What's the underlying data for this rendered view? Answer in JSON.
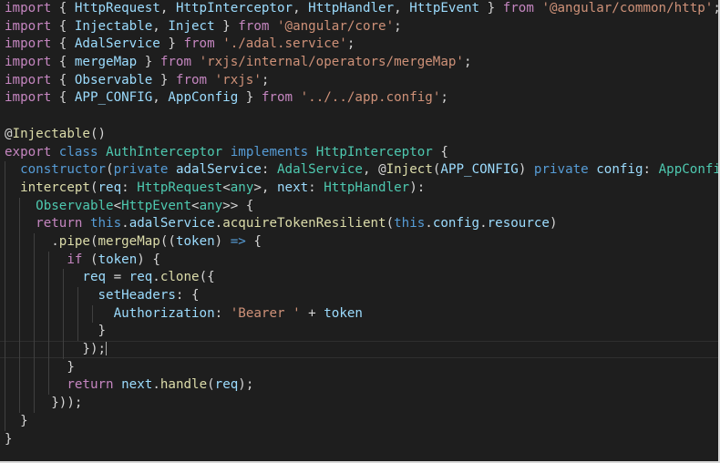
{
  "colors": {
    "background": "#1e1e1e",
    "plain": "#d4d4d4",
    "keyword": "#c586c0",
    "storage": "#569cd6",
    "variable": "#9cdcfe",
    "type": "#4ec9b0",
    "function": "#dcdcaa",
    "string": "#ce9178",
    "indent_guide": "#404040"
  },
  "editor": {
    "cursor_line": 19,
    "lines": [
      {
        "indent": 0,
        "guides": 0,
        "tokens": [
          {
            "t": "import",
            "c": "keyword"
          },
          {
            "t": " { ",
            "c": "plain"
          },
          {
            "t": "HttpRequest",
            "c": "variable"
          },
          {
            "t": ", ",
            "c": "plain"
          },
          {
            "t": "HttpInterceptor",
            "c": "variable"
          },
          {
            "t": ", ",
            "c": "plain"
          },
          {
            "t": "HttpHandler",
            "c": "variable"
          },
          {
            "t": ", ",
            "c": "plain"
          },
          {
            "t": "HttpEvent",
            "c": "variable"
          },
          {
            "t": " } ",
            "c": "plain"
          },
          {
            "t": "from",
            "c": "keyword"
          },
          {
            "t": " ",
            "c": "plain"
          },
          {
            "t": "'@angular/common/http'",
            "c": "string"
          },
          {
            "t": ";",
            "c": "plain"
          }
        ]
      },
      {
        "indent": 0,
        "guides": 0,
        "tokens": [
          {
            "t": "import",
            "c": "keyword"
          },
          {
            "t": " { ",
            "c": "plain"
          },
          {
            "t": "Injectable",
            "c": "variable"
          },
          {
            "t": ", ",
            "c": "plain"
          },
          {
            "t": "Inject",
            "c": "variable"
          },
          {
            "t": " } ",
            "c": "plain"
          },
          {
            "t": "from",
            "c": "keyword"
          },
          {
            "t": " ",
            "c": "plain"
          },
          {
            "t": "'@angular/core'",
            "c": "string"
          },
          {
            "t": ";",
            "c": "plain"
          }
        ]
      },
      {
        "indent": 0,
        "guides": 0,
        "tokens": [
          {
            "t": "import",
            "c": "keyword"
          },
          {
            "t": " { ",
            "c": "plain"
          },
          {
            "t": "AdalService",
            "c": "variable"
          },
          {
            "t": " } ",
            "c": "plain"
          },
          {
            "t": "from",
            "c": "keyword"
          },
          {
            "t": " ",
            "c": "plain"
          },
          {
            "t": "'./adal.service'",
            "c": "string"
          },
          {
            "t": ";",
            "c": "plain"
          }
        ]
      },
      {
        "indent": 0,
        "guides": 0,
        "tokens": [
          {
            "t": "import",
            "c": "keyword"
          },
          {
            "t": " { ",
            "c": "plain"
          },
          {
            "t": "mergeMap",
            "c": "variable"
          },
          {
            "t": " } ",
            "c": "plain"
          },
          {
            "t": "from",
            "c": "keyword"
          },
          {
            "t": " ",
            "c": "plain"
          },
          {
            "t": "'rxjs/internal/operators/mergeMap'",
            "c": "string"
          },
          {
            "t": ";",
            "c": "plain"
          }
        ]
      },
      {
        "indent": 0,
        "guides": 0,
        "tokens": [
          {
            "t": "import",
            "c": "keyword"
          },
          {
            "t": " { ",
            "c": "plain"
          },
          {
            "t": "Observable",
            "c": "variable"
          },
          {
            "t": " } ",
            "c": "plain"
          },
          {
            "t": "from",
            "c": "keyword"
          },
          {
            "t": " ",
            "c": "plain"
          },
          {
            "t": "'rxjs'",
            "c": "string"
          },
          {
            "t": ";",
            "c": "plain"
          }
        ]
      },
      {
        "indent": 0,
        "guides": 0,
        "tokens": [
          {
            "t": "import",
            "c": "keyword"
          },
          {
            "t": " { ",
            "c": "plain"
          },
          {
            "t": "APP_CONFIG",
            "c": "variable"
          },
          {
            "t": ", ",
            "c": "plain"
          },
          {
            "t": "AppConfig",
            "c": "variable"
          },
          {
            "t": " } ",
            "c": "plain"
          },
          {
            "t": "from",
            "c": "keyword"
          },
          {
            "t": " ",
            "c": "plain"
          },
          {
            "t": "'../../app.config'",
            "c": "string"
          },
          {
            "t": ";",
            "c": "plain"
          }
        ]
      },
      {
        "indent": 0,
        "guides": 0,
        "tokens": []
      },
      {
        "indent": 0,
        "guides": 0,
        "tokens": [
          {
            "t": "@",
            "c": "plain"
          },
          {
            "t": "Injectable",
            "c": "function"
          },
          {
            "t": "()",
            "c": "plain"
          }
        ]
      },
      {
        "indent": 0,
        "guides": 0,
        "tokens": [
          {
            "t": "export",
            "c": "keyword"
          },
          {
            "t": " ",
            "c": "plain"
          },
          {
            "t": "class",
            "c": "storage"
          },
          {
            "t": " ",
            "c": "plain"
          },
          {
            "t": "AuthInterceptor",
            "c": "type"
          },
          {
            "t": " ",
            "c": "plain"
          },
          {
            "t": "implements",
            "c": "storage"
          },
          {
            "t": " ",
            "c": "plain"
          },
          {
            "t": "HttpInterceptor",
            "c": "type"
          },
          {
            "t": " {",
            "c": "plain"
          }
        ]
      },
      {
        "indent": 2,
        "guides": 1,
        "tokens": [
          {
            "t": "constructor",
            "c": "storage"
          },
          {
            "t": "(",
            "c": "plain"
          },
          {
            "t": "private",
            "c": "storage"
          },
          {
            "t": " ",
            "c": "plain"
          },
          {
            "t": "adalService",
            "c": "variable"
          },
          {
            "t": ": ",
            "c": "plain"
          },
          {
            "t": "AdalService",
            "c": "type"
          },
          {
            "t": ", @",
            "c": "plain"
          },
          {
            "t": "Inject",
            "c": "function"
          },
          {
            "t": "(",
            "c": "plain"
          },
          {
            "t": "APP_CONFIG",
            "c": "variable"
          },
          {
            "t": ") ",
            "c": "plain"
          },
          {
            "t": "private",
            "c": "storage"
          },
          {
            "t": " ",
            "c": "plain"
          },
          {
            "t": "config",
            "c": "variable"
          },
          {
            "t": ": ",
            "c": "plain"
          },
          {
            "t": "AppConfig",
            "c": "type"
          },
          {
            "t": ") {}",
            "c": "plain"
          }
        ]
      },
      {
        "indent": 2,
        "guides": 1,
        "tokens": [
          {
            "t": "intercept",
            "c": "function"
          },
          {
            "t": "(",
            "c": "plain"
          },
          {
            "t": "req",
            "c": "variable"
          },
          {
            "t": ": ",
            "c": "plain"
          },
          {
            "t": "HttpRequest",
            "c": "type"
          },
          {
            "t": "<",
            "c": "plain"
          },
          {
            "t": "any",
            "c": "type"
          },
          {
            "t": ">, ",
            "c": "plain"
          },
          {
            "t": "next",
            "c": "variable"
          },
          {
            "t": ": ",
            "c": "plain"
          },
          {
            "t": "HttpHandler",
            "c": "type"
          },
          {
            "t": "):",
            "c": "plain"
          }
        ]
      },
      {
        "indent": 4,
        "guides": 2,
        "tokens": [
          {
            "t": "Observable",
            "c": "type"
          },
          {
            "t": "<",
            "c": "plain"
          },
          {
            "t": "HttpEvent",
            "c": "type"
          },
          {
            "t": "<",
            "c": "plain"
          },
          {
            "t": "any",
            "c": "type"
          },
          {
            "t": ">> {",
            "c": "plain"
          }
        ]
      },
      {
        "indent": 4,
        "guides": 2,
        "tokens": [
          {
            "t": "return",
            "c": "keyword"
          },
          {
            "t": " ",
            "c": "plain"
          },
          {
            "t": "this",
            "c": "storage"
          },
          {
            "t": ".",
            "c": "plain"
          },
          {
            "t": "adalService",
            "c": "variable"
          },
          {
            "t": ".",
            "c": "plain"
          },
          {
            "t": "acquireTokenResilient",
            "c": "function"
          },
          {
            "t": "(",
            "c": "plain"
          },
          {
            "t": "this",
            "c": "storage"
          },
          {
            "t": ".",
            "c": "plain"
          },
          {
            "t": "config",
            "c": "variable"
          },
          {
            "t": ".",
            "c": "plain"
          },
          {
            "t": "resource",
            "c": "variable"
          },
          {
            "t": ")",
            "c": "plain"
          }
        ]
      },
      {
        "indent": 6,
        "guides": 3,
        "tokens": [
          {
            "t": ".",
            "c": "plain"
          },
          {
            "t": "pipe",
            "c": "function"
          },
          {
            "t": "(",
            "c": "plain"
          },
          {
            "t": "mergeMap",
            "c": "function"
          },
          {
            "t": "((",
            "c": "plain"
          },
          {
            "t": "token",
            "c": "variable"
          },
          {
            "t": ") ",
            "c": "plain"
          },
          {
            "t": "=>",
            "c": "storage"
          },
          {
            "t": " {",
            "c": "plain"
          }
        ]
      },
      {
        "indent": 8,
        "guides": 4,
        "tokens": [
          {
            "t": "if",
            "c": "keyword"
          },
          {
            "t": " (",
            "c": "plain"
          },
          {
            "t": "token",
            "c": "variable"
          },
          {
            "t": ") {",
            "c": "plain"
          }
        ]
      },
      {
        "indent": 10,
        "guides": 5,
        "tokens": [
          {
            "t": "req",
            "c": "variable"
          },
          {
            "t": " = ",
            "c": "plain"
          },
          {
            "t": "req",
            "c": "variable"
          },
          {
            "t": ".",
            "c": "plain"
          },
          {
            "t": "clone",
            "c": "function"
          },
          {
            "t": "({",
            "c": "plain"
          }
        ]
      },
      {
        "indent": 12,
        "guides": 6,
        "tokens": [
          {
            "t": "setHeaders",
            "c": "variable"
          },
          {
            "t": ": {",
            "c": "plain"
          }
        ]
      },
      {
        "indent": 14,
        "guides": 7,
        "tokens": [
          {
            "t": "Authorization",
            "c": "variable"
          },
          {
            "t": ": ",
            "c": "plain"
          },
          {
            "t": "'Bearer '",
            "c": "string"
          },
          {
            "t": " + ",
            "c": "plain"
          },
          {
            "t": "token",
            "c": "variable"
          }
        ]
      },
      {
        "indent": 12,
        "guides": 6,
        "tokens": [
          {
            "t": "}",
            "c": "plain"
          }
        ]
      },
      {
        "indent": 10,
        "guides": 5,
        "tokens": [
          {
            "t": "});",
            "c": "plain"
          }
        ]
      },
      {
        "indent": 8,
        "guides": 4,
        "tokens": [
          {
            "t": "}",
            "c": "plain"
          }
        ]
      },
      {
        "indent": 8,
        "guides": 4,
        "tokens": [
          {
            "t": "return",
            "c": "keyword"
          },
          {
            "t": " ",
            "c": "plain"
          },
          {
            "t": "next",
            "c": "variable"
          },
          {
            "t": ".",
            "c": "plain"
          },
          {
            "t": "handle",
            "c": "function"
          },
          {
            "t": "(",
            "c": "plain"
          },
          {
            "t": "req",
            "c": "variable"
          },
          {
            "t": ");",
            "c": "plain"
          }
        ]
      },
      {
        "indent": 6,
        "guides": 3,
        "tokens": [
          {
            "t": "}));",
            "c": "plain"
          }
        ]
      },
      {
        "indent": 2,
        "guides": 1,
        "tokens": [
          {
            "t": "}",
            "c": "plain"
          }
        ]
      },
      {
        "indent": 0,
        "guides": 0,
        "tokens": [
          {
            "t": "}",
            "c": "plain"
          }
        ]
      }
    ]
  }
}
